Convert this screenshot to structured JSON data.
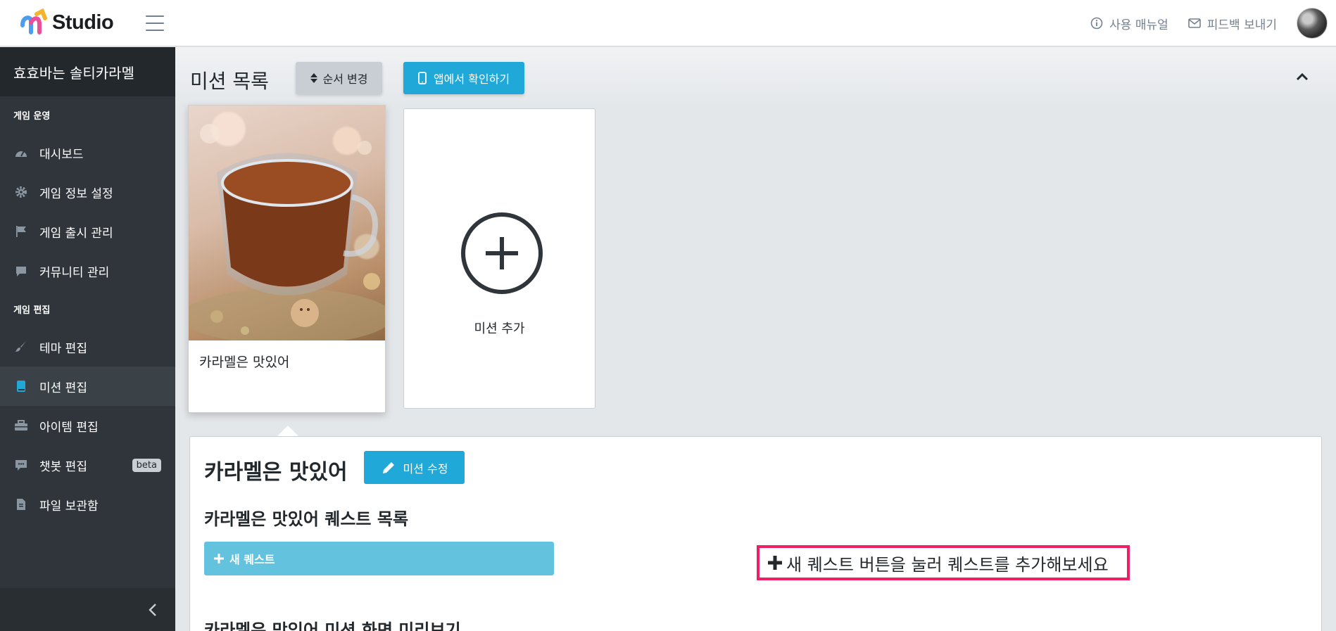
{
  "header": {
    "brand": "Studio",
    "manual_label": "사용 매뉴얼",
    "feedback_label": "피드백 보내기",
    "brand_colors": [
      "#f7b32b",
      "#e94f9b",
      "#4c9cf0"
    ]
  },
  "sidebar": {
    "title": "효효바는 솔티카라멜",
    "sections": [
      {
        "label": "게임 운영",
        "items": [
          {
            "label": "대시보드",
            "icon": "speedometer-icon"
          },
          {
            "label": "게임 정보 설정",
            "icon": "gear-icon"
          },
          {
            "label": "게임 출시 관리",
            "icon": "flag-icon"
          },
          {
            "label": "커뮤니티 관리",
            "icon": "speech-bubble-icon"
          }
        ]
      },
      {
        "label": "게임 편집",
        "items": [
          {
            "label": "테마 편집",
            "icon": "brush-icon"
          },
          {
            "label": "미션 편집",
            "icon": "book-icon",
            "active": true
          },
          {
            "label": "아이템 편집",
            "icon": "toolbox-icon"
          },
          {
            "label": "챗봇 편집",
            "icon": "chat-icon",
            "badge": "beta"
          },
          {
            "label": "파일 보관함",
            "icon": "file-icon"
          }
        ]
      }
    ]
  },
  "main": {
    "title": "미션 목록",
    "order_button": "순서 변경",
    "app_button": "앱에서 확인하기",
    "missions": [
      {
        "name": "카라멜은 맛있어"
      }
    ],
    "add_mission_label": "미션 추가",
    "detail": {
      "title": "카라멜은 맛있어",
      "edit_button": "미션 수정",
      "quest_list_heading": "카라멜은 맛있어 퀘스트 목록",
      "new_quest_button": "새 퀘스트",
      "hint": "새 퀘스트 버튼을 눌러 퀘스트를 추가해보세요",
      "preview_heading": "카라멜은 맛있어 미션 화면 미리보기"
    }
  },
  "colors": {
    "accent": "#20a8d8",
    "light_accent": "#63c2de",
    "highlight": "#ee1f66",
    "sidebar_bg": "#2f353a"
  }
}
